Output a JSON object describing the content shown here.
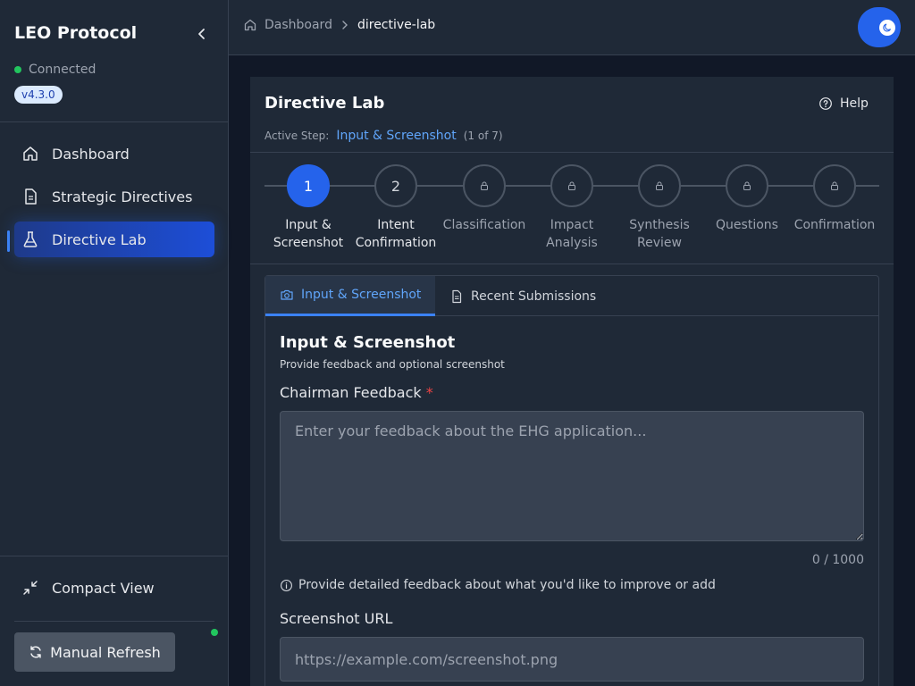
{
  "sidebar": {
    "brand": "LEO Protocol",
    "status": "Connected",
    "version": "v4.3.0",
    "nav": [
      {
        "label": "Dashboard",
        "icon": "home-icon"
      },
      {
        "label": "Strategic Directives",
        "icon": "document-icon"
      },
      {
        "label": "Directive Lab",
        "icon": "flask-icon",
        "active": true
      }
    ],
    "compact_label": "Compact View",
    "refresh_label": "Manual Refresh"
  },
  "header": {
    "breadcrumb_home": "Dashboard",
    "breadcrumb_current": "directive-lab"
  },
  "card": {
    "title": "Directive Lab",
    "help_label": "Help",
    "active_step_label": "Active Step:",
    "active_step_name": "Input & Screenshot",
    "active_step_count": "(1 of 7)"
  },
  "steps": [
    {
      "number": "1",
      "line1": "Input &",
      "line2": "Screenshot",
      "state": "active"
    },
    {
      "number": "2",
      "line1": "Intent",
      "line2": "Confirmation",
      "state": "available"
    },
    {
      "number": "",
      "line1": "Classification",
      "line2": "",
      "state": "locked"
    },
    {
      "number": "",
      "line1": "Impact",
      "line2": "Analysis",
      "state": "locked"
    },
    {
      "number": "",
      "line1": "Synthesis",
      "line2": "Review",
      "state": "locked"
    },
    {
      "number": "",
      "line1": "Questions",
      "line2": "",
      "state": "locked"
    },
    {
      "number": "",
      "line1": "Confirmation",
      "line2": "",
      "state": "locked"
    }
  ],
  "tabs": {
    "input": "Input & Screenshot",
    "recent": "Recent Submissions"
  },
  "form": {
    "section_title": "Input & Screenshot",
    "section_subtitle": "Provide feedback and optional screenshot",
    "feedback_label": "Chairman Feedback",
    "required_mark": "*",
    "feedback_placeholder": "Enter your feedback about the EHG application...",
    "feedback_value": "",
    "counter": "0 / 1000",
    "hint": "Provide detailed feedback about what you'd like to improve or add",
    "screenshot_label": "Screenshot URL",
    "screenshot_placeholder": "https://example.com/screenshot.png",
    "screenshot_value": ""
  },
  "colors": {
    "accent": "#2563eb",
    "link": "#60a5fa",
    "success": "#22c55e",
    "required": "#ef4444"
  }
}
